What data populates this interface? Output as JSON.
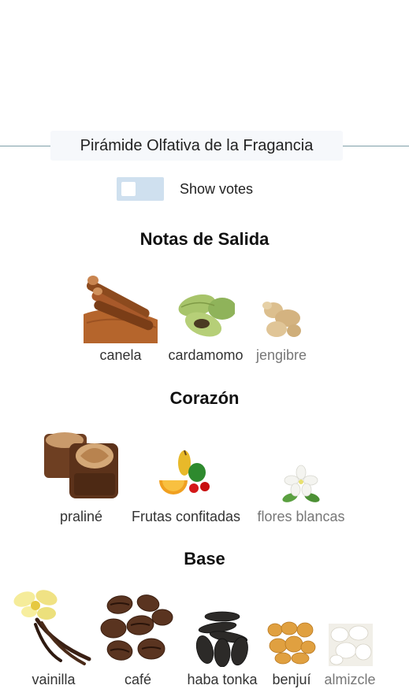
{
  "pyramid": {
    "title": "Pirámide Olfativa de la Fragancia",
    "show_votes_label": "Show votes",
    "sections": {
      "top": {
        "title": "Notas de Salida",
        "notes": [
          {
            "name": "canela",
            "icon": "cinnamon-icon"
          },
          {
            "name": "cardamomo",
            "icon": "cardamom-icon"
          },
          {
            "name": "jengibre",
            "icon": "ginger-icon"
          }
        ]
      },
      "heart": {
        "title": "Corazón",
        "notes": [
          {
            "name": "praliné",
            "icon": "praline-icon"
          },
          {
            "name": "Frutas confitadas",
            "icon": "candied-fruits-icon"
          },
          {
            "name": "flores blancas",
            "icon": "white-flowers-icon"
          }
        ]
      },
      "base": {
        "title": "Base",
        "notes": [
          {
            "name": "vainilla",
            "icon": "vanilla-icon"
          },
          {
            "name": "café",
            "icon": "coffee-icon"
          },
          {
            "name": "haba tonka",
            "icon": "tonka-bean-icon"
          },
          {
            "name": "benjuí",
            "icon": "benzoin-icon"
          },
          {
            "name": "almizcle",
            "icon": "musk-icon"
          }
        ]
      }
    }
  },
  "colors": {
    "accent_line": "#7f9fa8",
    "toggle_bg": "#cfe0ef",
    "title_bg": "#f6f8fb"
  }
}
